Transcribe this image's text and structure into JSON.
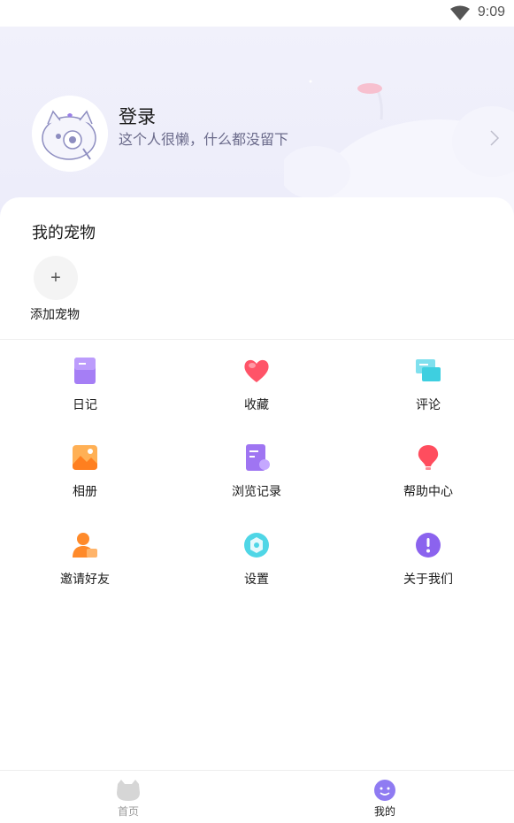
{
  "status_bar": {
    "time": "9:09"
  },
  "profile": {
    "title": "登录",
    "subtitle": "这个人很懒，什么都没留下"
  },
  "pets": {
    "title": "我的宠物",
    "add_label": "添加宠物",
    "add_symbol": "+"
  },
  "menu": [
    {
      "label": "日记",
      "icon": "diary-icon",
      "color": "#9b6cf0"
    },
    {
      "label": "收藏",
      "icon": "heart-icon",
      "color": "#ff4d5e"
    },
    {
      "label": "评论",
      "icon": "comment-icon",
      "color": "#3ed0e0"
    },
    {
      "label": "相册",
      "icon": "album-icon",
      "color": "#ff8a2a"
    },
    {
      "label": "浏览记录",
      "icon": "history-icon",
      "color": "#9b6cf0"
    },
    {
      "label": "帮助中心",
      "icon": "help-icon",
      "color": "#ff4d5e"
    },
    {
      "label": "邀请好友",
      "icon": "invite-icon",
      "color": "#ff8a2a"
    },
    {
      "label": "设置",
      "icon": "settings-icon",
      "color": "#3ed0e0"
    },
    {
      "label": "关于我们",
      "icon": "about-icon",
      "color": "#8b63ee"
    }
  ],
  "tabbar": {
    "home_label": "首页",
    "mine_label": "我的",
    "active_color": "#1a1a1a",
    "inactive_color": "#9a9a9a"
  }
}
